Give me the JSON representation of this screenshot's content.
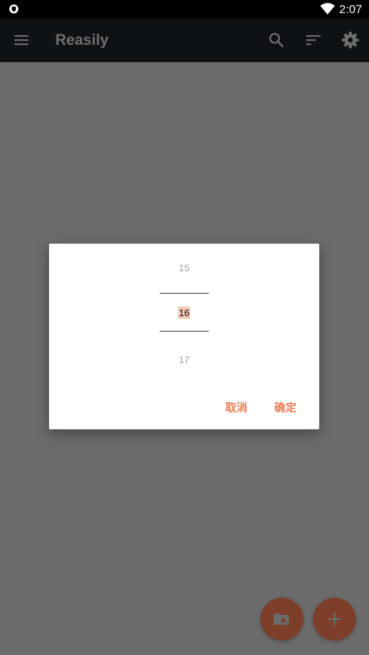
{
  "status_bar": {
    "time": "2:07"
  },
  "app_bar": {
    "title": "Reasily"
  },
  "dialog": {
    "picker": {
      "above": "15",
      "selected": "16",
      "below": "17"
    },
    "cancel_label": "取消",
    "ok_label": "确定"
  },
  "colors": {
    "accent": "#f07a52",
    "fab": "#7e3f2a",
    "app_bar": "#0f1214",
    "scrim": "#6b6b6b",
    "selected_highlight": "#f8c7b6"
  },
  "icons": {
    "status_left": "shield-icon",
    "status_right": "wifi-icon",
    "app_bar_left": "menu-icon",
    "app_bar_right": [
      "search-icon",
      "sort-icon",
      "gear-icon"
    ],
    "fab_left": "folder-search-icon",
    "fab_right": "plus-icon"
  }
}
